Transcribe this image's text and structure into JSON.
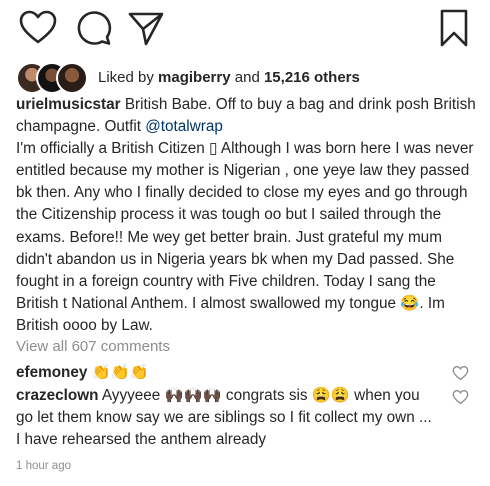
{
  "actions": {
    "like_icon": "heart-outline",
    "comment_icon": "speech-bubble",
    "share_icon": "paper-plane",
    "save_icon": "bookmark"
  },
  "likes": {
    "prefix": "Liked by ",
    "user": "magiberry",
    "connector": " and ",
    "others": "15,216 others"
  },
  "caption": {
    "username": "urielmusicstar",
    "text_before_mention": "British Babe. Off to buy a bag and drink posh British champagne. Outfit ",
    "mention": "@totalwrap",
    "body": "I'm officially a British Citizen ▯ Although I was born here I was never entitled because my mother is Nigerian , one yeye law they passed bk then. Any who I finally decided to close my eyes and go through the Citizenship process it was tough oo but I sailed through the exams.  Before!! Me wey get better brain. Just grateful my mum didn't abandon us in Nigeria years bk when my Dad passed. She fought in a foreign country with Five children. Today I sang the British t National Anthem. I almost swallowed my tongue ",
    "body_emoji": "😂",
    "body_end": ". Im British oooo by Law."
  },
  "view_all": "View all 607 comments",
  "comments": [
    {
      "username": "efemoney",
      "text": "👏👏👏"
    },
    {
      "username": "crazeclown",
      "text_a": "Ayyyeee ",
      "emoji_a": "🙌🏿🙌🏿🙌🏿",
      "text_b": " congrats sis ",
      "emoji_b": "😩😩",
      "text_c": " when you go let them know say we are siblings so I fit collect my own ... I have rehearsed the anthem already"
    }
  ],
  "timestamp": "1 hour ago",
  "colors": {
    "text": "#262626",
    "muted": "#8e8e8e",
    "mention": "#003569"
  }
}
